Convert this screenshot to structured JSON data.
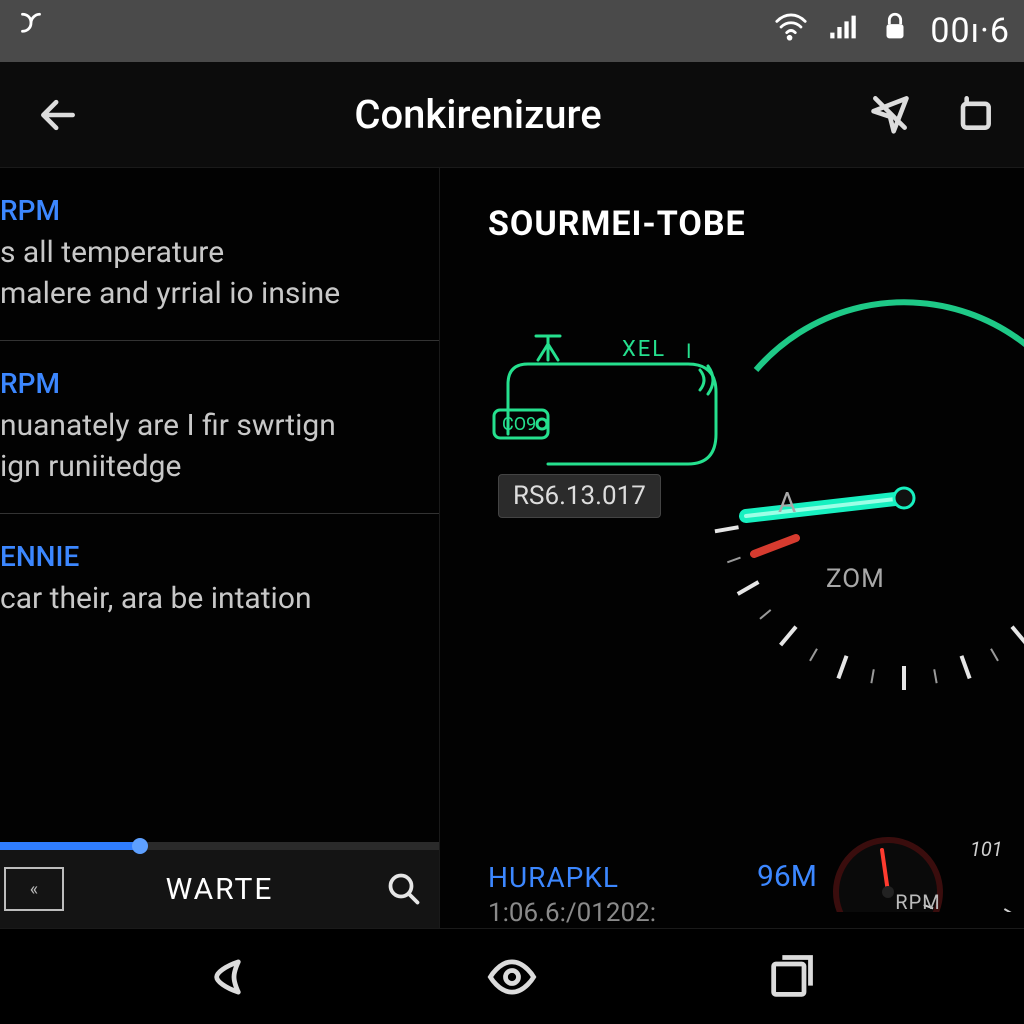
{
  "sysbar": {
    "clock": "00ı·6"
  },
  "titlebar": {
    "title": "Conkirenizure"
  },
  "list": {
    "items": [
      {
        "title": "RPM",
        "desc": "s all temperature\nmalere and yrrial io insine"
      },
      {
        "title": "RPM",
        "desc": "nuanately are I fir swrtign\nign runiitedge"
      },
      {
        "title": "ENNIE",
        "desc": "car their, ara be intation"
      }
    ],
    "progress_pct": 32,
    "bottom_label": "WARTE",
    "chip_label": "«"
  },
  "right": {
    "heading": "SOURMEI-TOBE",
    "diagram_label_top": "XEL",
    "diagram_label_co": "CO9",
    "version": "RS6.13.017",
    "gauge_A": "A",
    "gauge_ZOM": "ZOM",
    "footer_key": "HURAPKL",
    "footer_val": "96M",
    "sub": "1:06.6:/01202:",
    "mini_label": "RPM",
    "mini_tick": "101"
  },
  "colors": {
    "accent_blue": "#3c87ff",
    "accent_green": "#25e08e",
    "needle_red": "#d63b2f"
  }
}
